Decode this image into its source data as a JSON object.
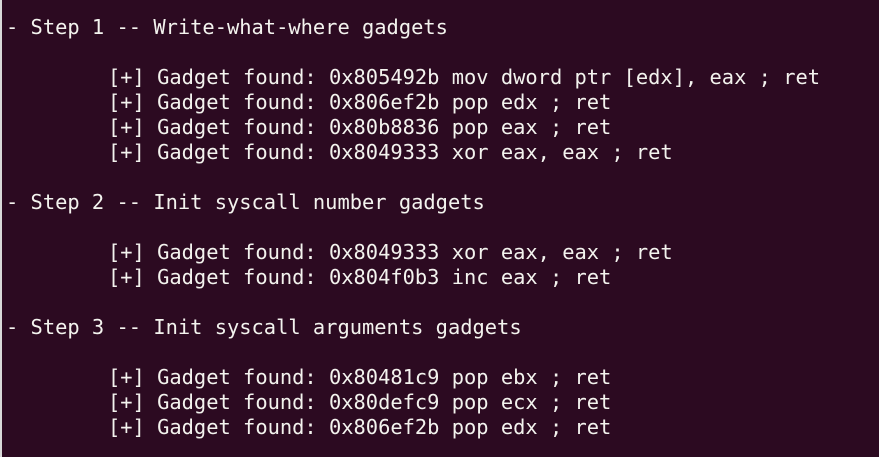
{
  "terminal": {
    "steps": [
      {
        "header": "- Step 1 -- Write-what-where gadgets",
        "gadgets": [
          "[+] Gadget found: 0x805492b mov dword ptr [edx], eax ; ret",
          "[+] Gadget found: 0x806ef2b pop edx ; ret",
          "[+] Gadget found: 0x80b8836 pop eax ; ret",
          "[+] Gadget found: 0x8049333 xor eax, eax ; ret"
        ]
      },
      {
        "header": "- Step 2 -- Init syscall number gadgets",
        "gadgets": [
          "[+] Gadget found: 0x8049333 xor eax, eax ; ret",
          "[+] Gadget found: 0x804f0b3 inc eax ; ret"
        ]
      },
      {
        "header": "- Step 3 -- Init syscall arguments gadgets",
        "gadgets": [
          "[+] Gadget found: 0x80481c9 pop ebx ; ret",
          "[+] Gadget found: 0x80defc9 pop ecx ; ret",
          "[+] Gadget found: 0x806ef2b pop edx ; ret"
        ]
      }
    ]
  }
}
